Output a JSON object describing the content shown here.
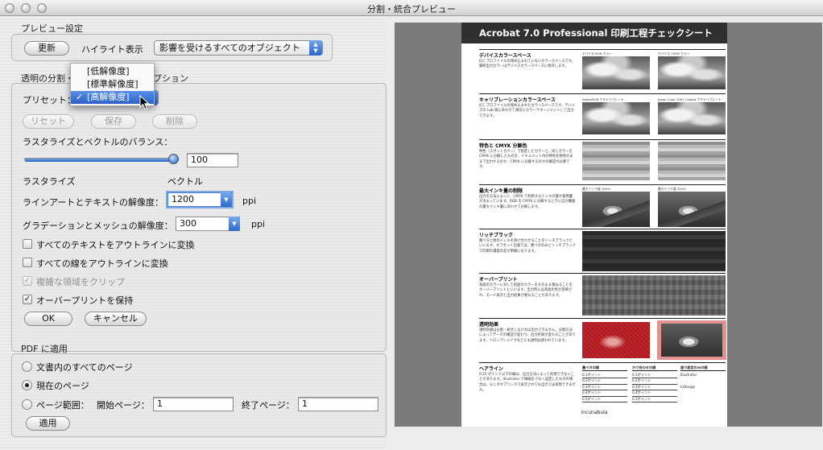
{
  "window": {
    "title": "分割・統合プレビュー"
  },
  "preview_settings": {
    "section_label": "プレビュー設定",
    "refresh_label": "更新",
    "highlight_label": "ハイライト表示",
    "highlight_value": "影響を受けるすべてのオブジェクト"
  },
  "flattener": {
    "section_label_left": "透明の分割・",
    "section_label_right": "プション",
    "preset_label": "プリセット：",
    "preset_menu": [
      {
        "label": "[低解像度]",
        "selected": false
      },
      {
        "label": "[標準解像度]",
        "selected": false
      },
      {
        "label": "[高解像度]",
        "selected": true
      }
    ],
    "reset_label": "リセット",
    "save_label": "保存",
    "delete_label": "削除",
    "balance_label": "ラスタライズとベクトルのバランス：",
    "balance_value": "100",
    "balance_fraction": 1.0,
    "raster_label": "ラスタライズ",
    "vector_label": "ベクトル",
    "lineart_label": "ラインアートとテキストの解像度：",
    "lineart_value": "1200",
    "gradient_label": "グラデーションとメッシュの解像度：",
    "gradient_value": "300",
    "unit_ppi": "ppi",
    "checkboxes": [
      {
        "label": "すべてのテキストをアウトラインに変換",
        "checked": false,
        "enabled": true
      },
      {
        "label": "すべての線をアウトラインに変換",
        "checked": false,
        "enabled": true
      },
      {
        "label": "複雑な領域をクリップ",
        "checked": true,
        "enabled": false
      },
      {
        "label": "オーバープリントを保持",
        "checked": true,
        "enabled": true
      }
    ],
    "ok_label": "OK",
    "cancel_label": "キャンセル"
  },
  "pdf_apply": {
    "section_label": "PDF に適用",
    "all_pages_label": "文書内のすべてのページ",
    "current_page_label": "現在のページ",
    "range_label": "ページ範囲：",
    "start_label": "開始ページ：",
    "start_value": "1",
    "end_label": "終了ページ：",
    "end_value": "1",
    "apply_label": "適用",
    "selected_option": "current_page"
  },
  "sheet": {
    "title": "Acrobat 7.0 Professional 印刷工程チェックシート",
    "sections": [
      {
        "title": "デバイスカラースペース",
        "text": "ICC プロファイルの埋め込まれていないカラースペースです。最終出力カラーはデバイスカラースペースに依存します。",
        "captions": [
          "デバイス RGB カラー",
          "デバイス CMYK カラー"
        ]
      },
      {
        "title": "キャリブレーションカラースペース",
        "text": "ICC プロファイルの埋め込まれたカラースペースです。デバイスの Lab 値にあわせて適切にカラーマネージメントして出力できます。",
        "captions": [
          "AdobeRGB でキャリブレート",
          "Japan Color 2001 Coated でキャリブレート"
        ]
      },
      {
        "title": "特色と CMYK 分解色",
        "text": "特色（スポットカラー）で指定したカラーと、同じカラーを CMYK に分解したものを、ドキュメント内の特色を特色のままで出力するのか、CMYK に分解するのかの確認が必要です。",
        "captions": [
          "",
          ""
        ]
      },
      {
        "title": "最大インキ量の制限",
        "text": "出力の方法によって、CMYK で利用するインキの最大使用量が決まっています。RGB を CMYK に分解するときに出力機器の最大インキ量にあわせて分解します。",
        "captions": [
          "最大インキ量 300%",
          "最大インキ量 350%"
        ]
      },
      {
        "title": "リッチブラック",
        "text": "墨ベタと他のインキを掛け合わせることをリッチブラックといいます。オフセット出版では、墨ベタのみとリッチブラックで印刷の濃度の差が明確になります。",
        "captions": []
      },
      {
        "title": "オーバープリント",
        "text": "背面のカラーに対して前面のカラーをそのまま重ねることをオーバープリントといいます。出力時には背面の色が反映され、モード表示と出力結果が異なることがあります。",
        "captions": []
      },
      {
        "title": "透明効果",
        "text": "透明効果は分割・統合しなければ出力できません。分割方法によってデータの構造が変わり、出力結果が変わることがあります。ドロップシャドウなどにも透明は使われています。",
        "captions": []
      },
      {
        "title": "ヘアライン",
        "text": "0.25 ポイント以下の線は、出力方法によって再現できないことがあります。Illustrator で線幅を少なく設定したものの場合は、モニタやプリンタで表示されても出力では再現できません。",
        "captions": []
      }
    ],
    "hairline_cols": [
      {
        "head": "墨ベタの線",
        "rows": [
          "0.1ポイント",
          "0.2ポイント",
          "0.3ポイント",
          "0.4ポイント",
          "0.5ポイント"
        ]
      },
      {
        "head": "かけ合わせの線",
        "rows": [
          "0.1ポイント",
          "0.2ポイント",
          "0.3ポイント",
          "0.4ポイント",
          "0.5ポイント"
        ]
      },
      {
        "head": "塗り設定のみの線",
        "rows": [
          "Illustrator",
          "",
          "InDesign",
          "",
          ""
        ]
      }
    ],
    "footer": "incunabula"
  }
}
